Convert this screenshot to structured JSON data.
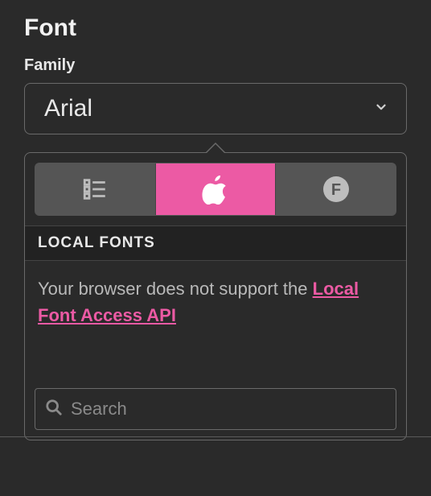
{
  "section": {
    "title": "Font"
  },
  "family": {
    "label": "Family",
    "value": "Arial"
  },
  "popover": {
    "tabs": {
      "list_icon": "list-icon",
      "apple_icon": "apple-icon",
      "font_badge_icon": "font-badge-icon",
      "active_index": 1
    },
    "subheading": "LOCAL FONTS",
    "message_prefix": "Your browser does not support the ",
    "message_link": "Local Font Access API"
  },
  "search": {
    "placeholder": "Search",
    "value": ""
  },
  "colors": {
    "accent": "#ec5aa4",
    "border": "#6a6a6a",
    "bg": "#2a2a2a"
  }
}
